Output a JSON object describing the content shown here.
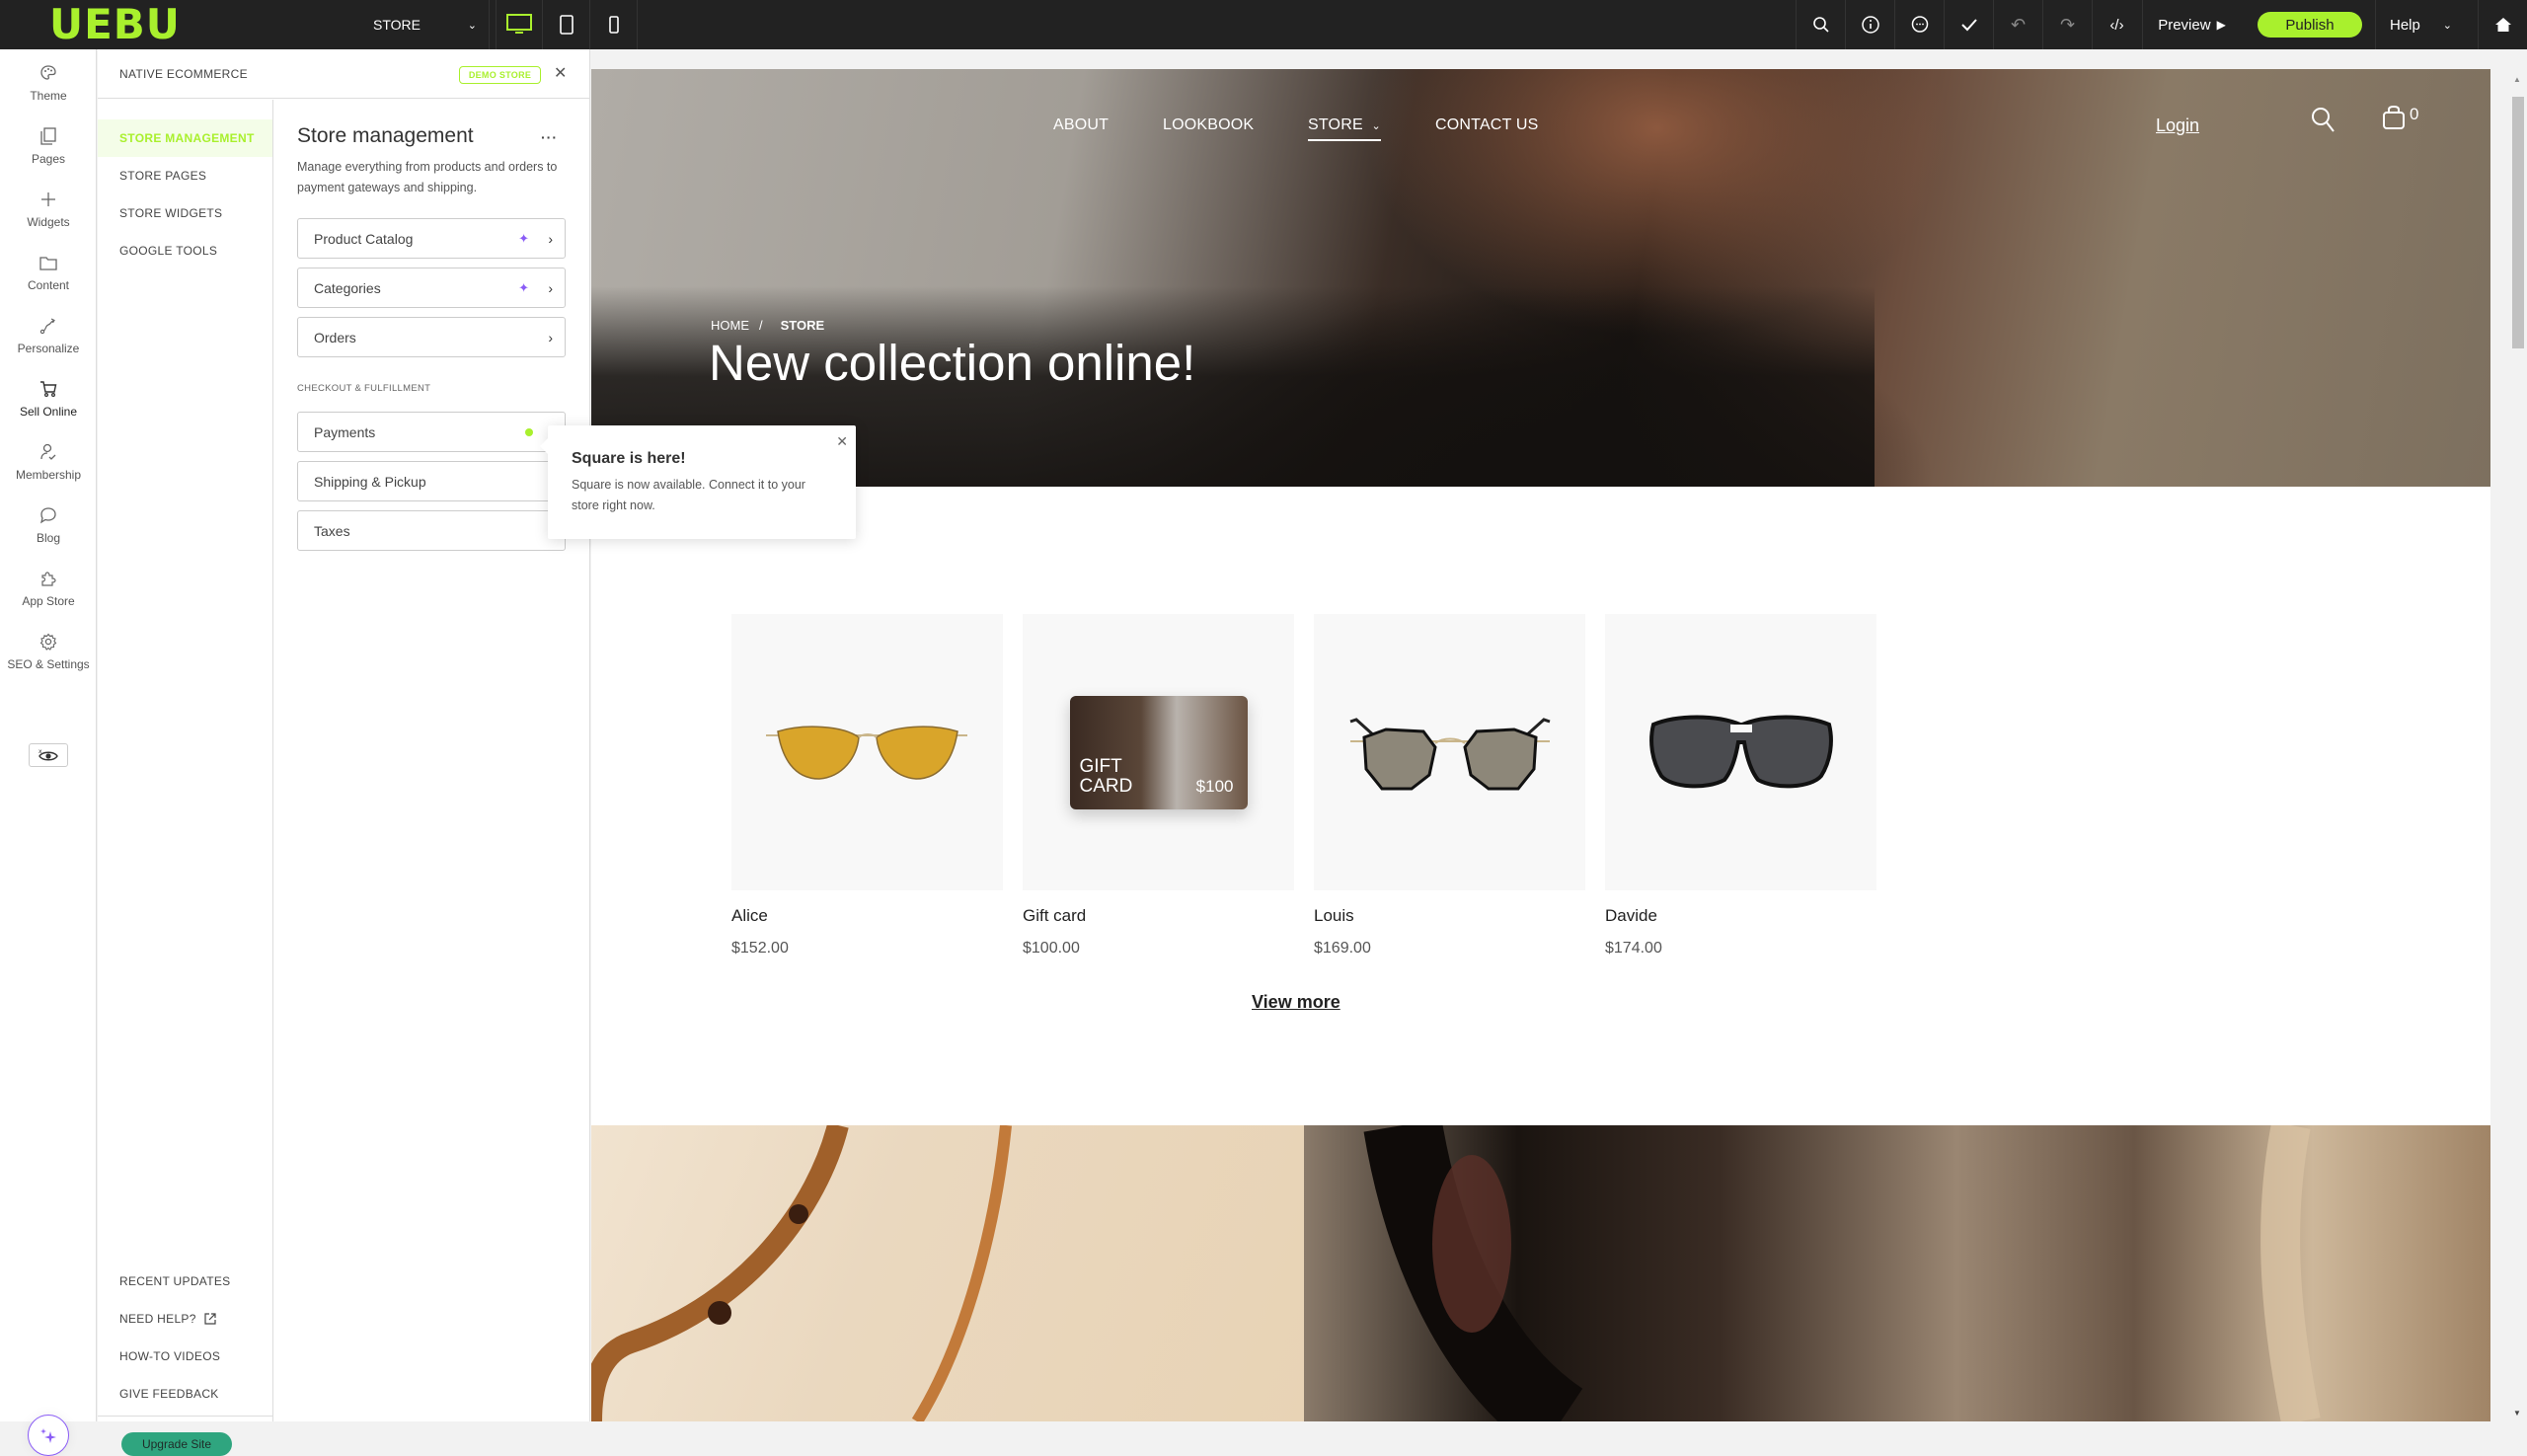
{
  "topbar": {
    "logo": "UEBU",
    "page_selector": "STORE",
    "devices": [
      "desktop-icon",
      "tablet-icon",
      "mobile-icon"
    ],
    "active_device": "desktop",
    "tools": [
      "search-icon",
      "info-icon",
      "comment-icon",
      "check-icon",
      "undo-icon",
      "redo-icon",
      "code-icon"
    ],
    "preview_label": "Preview",
    "publish_label": "Publish",
    "help_label": "Help",
    "accent_color": "#a9f02d"
  },
  "rail": {
    "items": [
      {
        "label": "Theme",
        "icon": "palette-icon"
      },
      {
        "label": "Pages",
        "icon": "pages-icon"
      },
      {
        "label": "Widgets",
        "icon": "plus-icon"
      },
      {
        "label": "Content",
        "icon": "folder-icon"
      },
      {
        "label": "Personalize",
        "icon": "personalize-icon"
      },
      {
        "label": "Sell Online",
        "icon": "cart-icon"
      },
      {
        "label": "Membership",
        "icon": "user-check-icon"
      },
      {
        "label": "Blog",
        "icon": "chat-bubble-icon"
      },
      {
        "label": "App Store",
        "icon": "puzzle-icon"
      },
      {
        "label": "SEO & Settings",
        "icon": "gear-icon"
      }
    ]
  },
  "panel": {
    "title": "NATIVE ECOMMERCE",
    "badge": "DEMO STORE",
    "subnav": [
      "STORE MANAGEMENT",
      "STORE PAGES",
      "STORE WIDGETS",
      "GOOGLE TOOLS"
    ],
    "active_subnav": "STORE MANAGEMENT",
    "bottom_links": [
      "RECENT UPDATES",
      "NEED HELP?",
      "HOW-TO VIDEOS",
      "GIVE FEEDBACK"
    ],
    "upgrade_label": "Upgrade Site",
    "heading": "Store management",
    "description": "Manage everything from products and orders to payment gateways and shipping.",
    "main_rows": [
      "Product Catalog",
      "Categories",
      "Orders"
    ],
    "section_label": "CHECKOUT & FULFILLMENT",
    "checkout_rows": [
      "Payments",
      "Shipping & Pickup",
      "Taxes"
    ]
  },
  "tooltip": {
    "title": "Square is here!",
    "body": "Square is now available. Connect it to your store right now."
  },
  "site": {
    "nav": [
      "ABOUT",
      "LOOKBOOK",
      "STORE",
      "CONTACT US"
    ],
    "active_nav": "STORE",
    "login": "Login",
    "cart_count": "0",
    "breadcrumb": {
      "home": "HOME",
      "sep": "/",
      "current": "STORE"
    },
    "hero_title": "New collection online!",
    "products": [
      {
        "name": "Alice",
        "price": "$152.00"
      },
      {
        "name": "Gift card",
        "price": "$100.00"
      },
      {
        "name": "Louis",
        "price": "$169.00"
      },
      {
        "name": "Davide",
        "price": "$174.00"
      }
    ],
    "gift_card": {
      "label_line1": "GIFT",
      "label_line2": "CARD",
      "amount": "$100"
    },
    "view_more": "View more"
  }
}
